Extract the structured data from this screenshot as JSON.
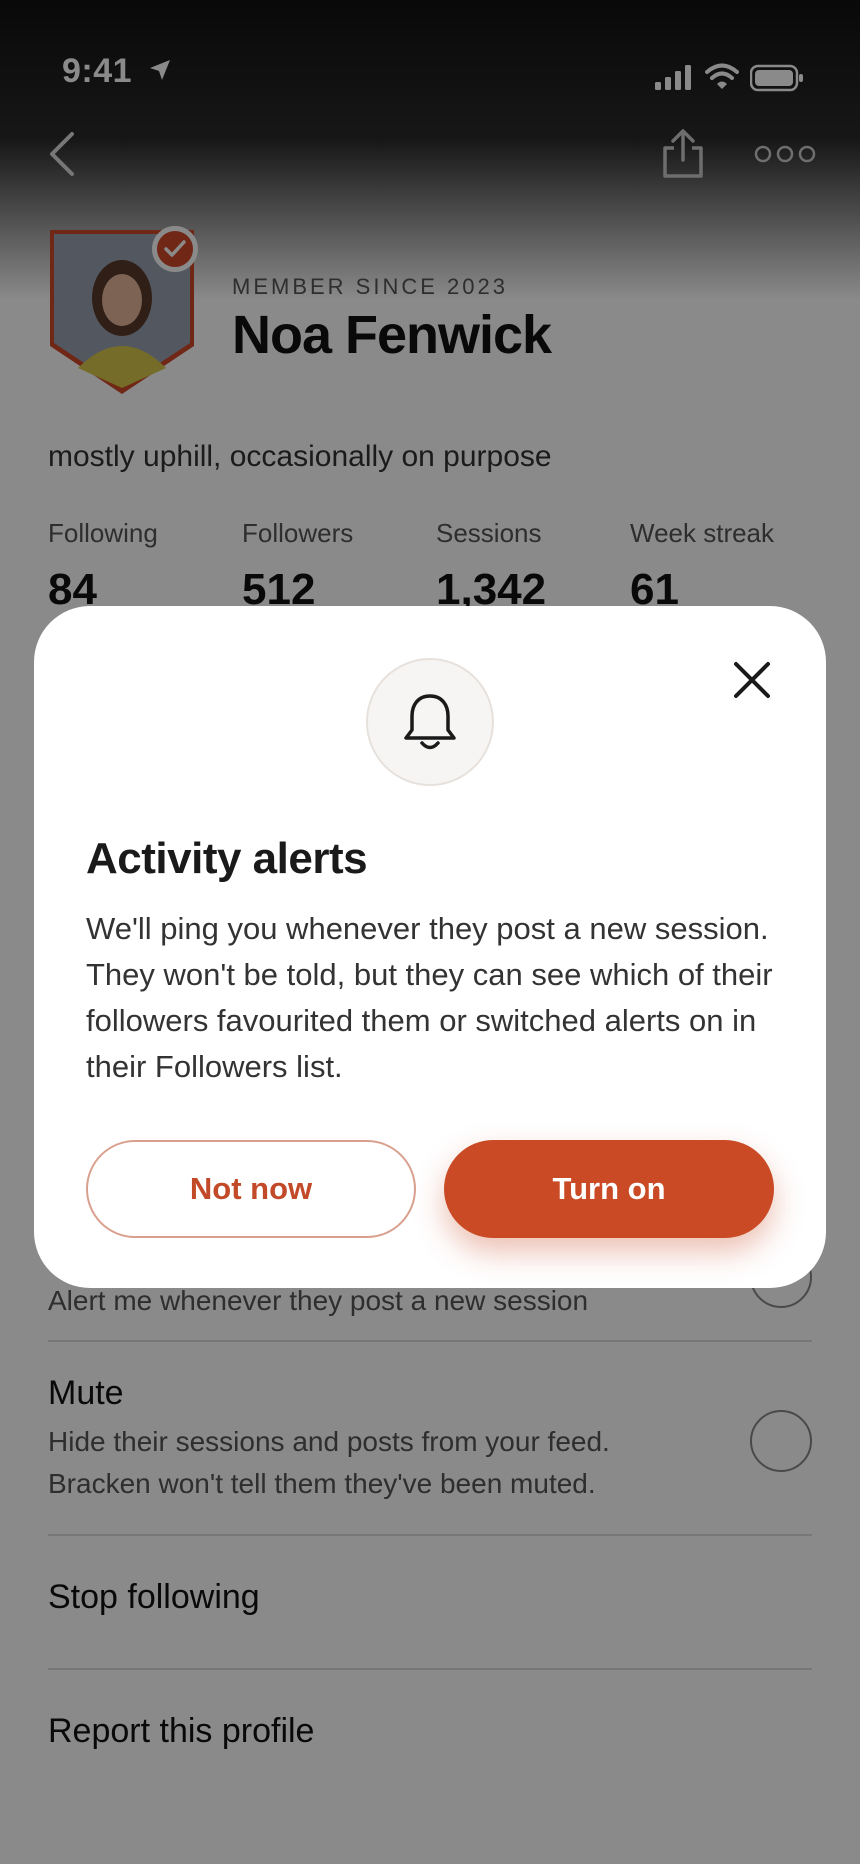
{
  "status_bar": {
    "time": "9:41"
  },
  "profile": {
    "member_since": "MEMBER SINCE 2023",
    "name": "Noa Fenwick",
    "bio": "mostly uphill, occasionally on purpose",
    "stats": [
      {
        "label": "Following",
        "value": "84"
      },
      {
        "label": "Followers",
        "value": "512"
      },
      {
        "label": "Sessions",
        "value": "1,342"
      },
      {
        "label": "Week streak",
        "value": "61"
      }
    ]
  },
  "sheet": {
    "alerts_row": {
      "subtitle": "Alert me whenever they post a new session"
    },
    "mute_row": {
      "title": "Mute",
      "subtitle_line1": "Hide their sessions and posts from your feed.",
      "subtitle_line2": "Bracken won't tell them they've been muted."
    },
    "stop_following": "Stop following",
    "report": "Report this profile"
  },
  "modal": {
    "title": "Activity alerts",
    "body": "We'll ping you whenever they post a new session. They won't be told, but they can see which of their followers favourited them or switched alerts on in their Followers list.",
    "secondary_button": "Not now",
    "primary_button": "Turn on"
  },
  "colors": {
    "accent": "#c94a25",
    "accent_border": "#d9a08e"
  },
  "icons": [
    "location-arrow-icon",
    "signal-icon",
    "wifi-icon",
    "battery-icon",
    "back-chevron-icon",
    "share-icon",
    "more-icon",
    "verified-badge-icon",
    "bell-icon",
    "close-icon"
  ]
}
